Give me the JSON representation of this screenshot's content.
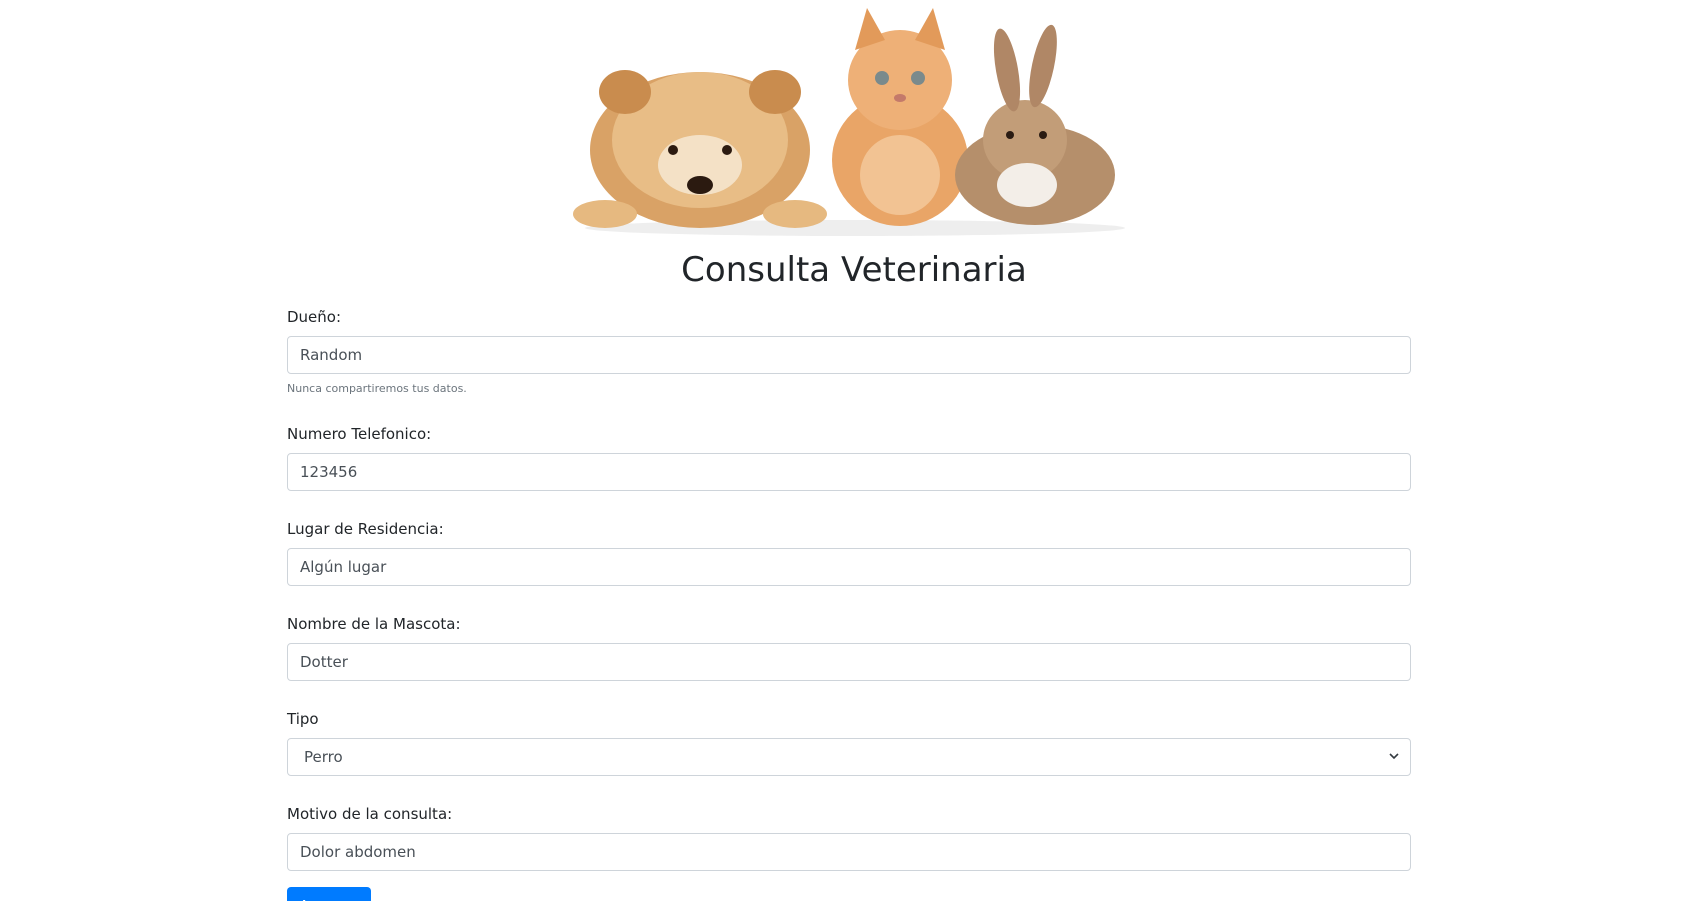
{
  "header": {
    "title": "Consulta Veterinaria"
  },
  "form": {
    "owner": {
      "label": "Dueño:",
      "value": "Random",
      "help": "Nunca compartiremos tus datos."
    },
    "phone": {
      "label": "Numero Telefonico:",
      "value": "123456"
    },
    "residence": {
      "label": "Lugar de Residencia:",
      "value": "Algún lugar"
    },
    "pet_name": {
      "label": "Nombre de la Mascota:",
      "value": "Dotter"
    },
    "type": {
      "label": "Tipo",
      "selected": "Perro"
    },
    "reason": {
      "label": "Motivo de la consulta:",
      "value": "Dolor abdomen"
    },
    "submit_label": "Agregar"
  },
  "colors": {
    "primary": "#007bff",
    "border": "#ced4da",
    "help_text": "#6c757d"
  }
}
